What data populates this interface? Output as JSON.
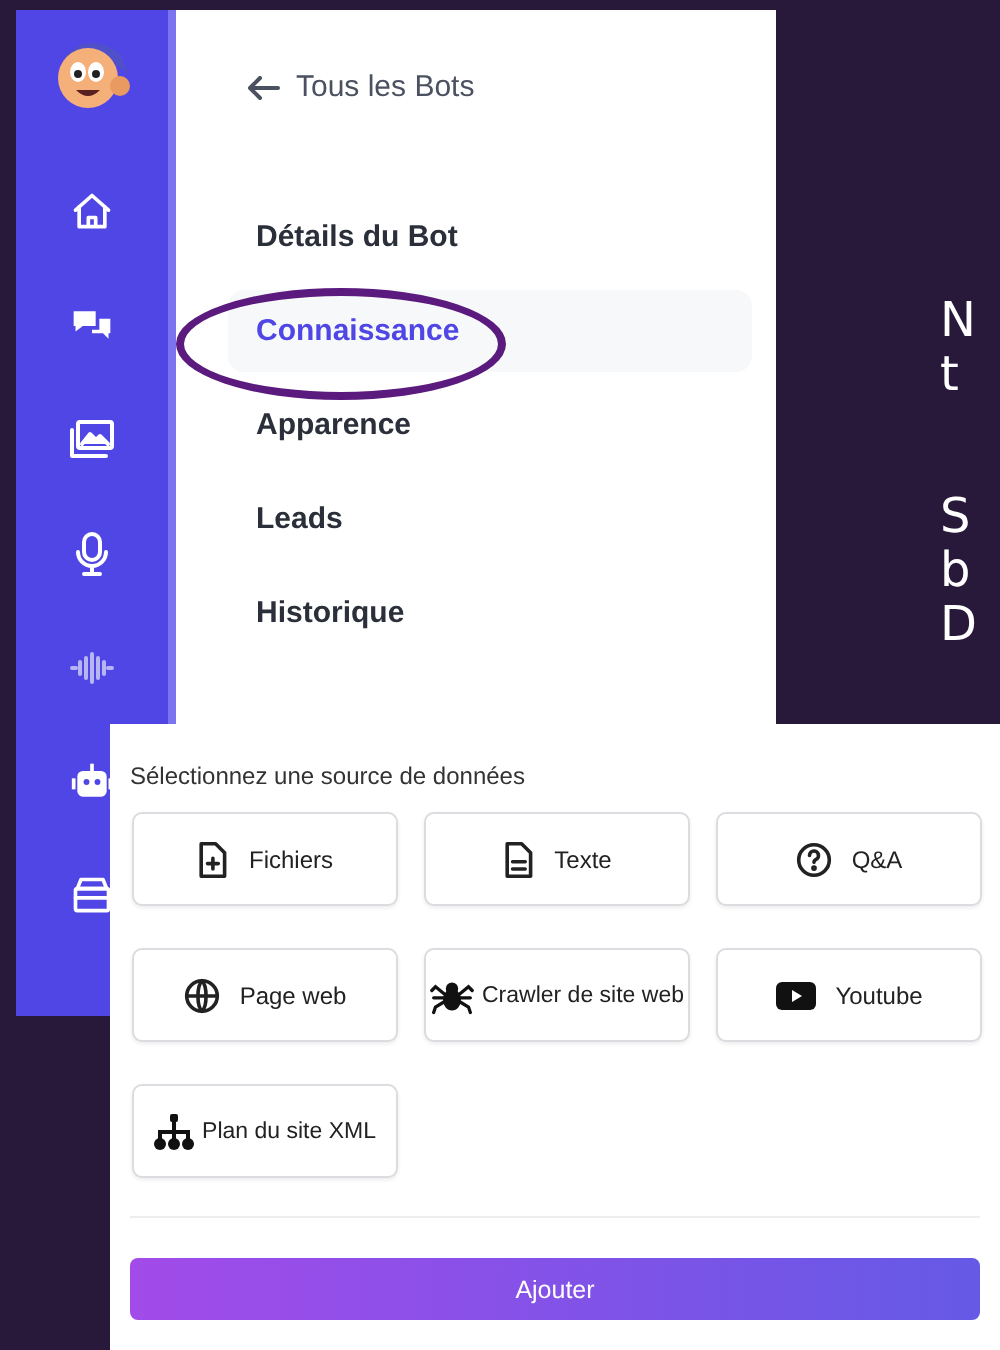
{
  "panel": {
    "back_link": "Tous les Bots",
    "menu": [
      {
        "label": "Détails du Bot",
        "selected": false,
        "circled": false
      },
      {
        "label": "Connaissance",
        "selected": true,
        "circled": true
      },
      {
        "label": "Apparence",
        "selected": false,
        "circled": false
      },
      {
        "label": "Leads",
        "selected": false,
        "circled": false
      },
      {
        "label": "Historique",
        "selected": false,
        "circled": false
      }
    ]
  },
  "side_text": [
    {
      "kind": "body",
      "text": "N"
    },
    {
      "kind": "body",
      "text": "t"
    },
    {
      "kind": "gap"
    },
    {
      "kind": "body",
      "text": "S"
    },
    {
      "kind": "body",
      "text": "b"
    },
    {
      "kind": "body",
      "text": "D"
    }
  ],
  "source_dialog": {
    "prompt": "Sélectionnez une source de données",
    "sources": [
      {
        "label": "Fichiers"
      },
      {
        "label": "Texte"
      },
      {
        "label": "Q&A"
      },
      {
        "label": "Page web"
      },
      {
        "label": "Crawler de site web"
      },
      {
        "label": "Youtube"
      },
      {
        "label": "Plan du site XML"
      }
    ],
    "submit": "Ajouter"
  }
}
